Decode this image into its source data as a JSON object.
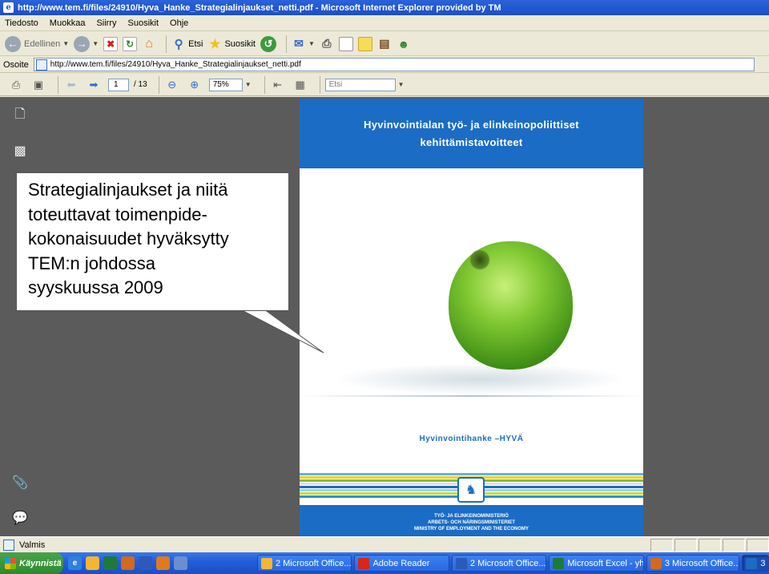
{
  "window": {
    "title": "http://www.tem.fi/files/24910/Hyva_Hanke_Strategialinjaukset_netti.pdf - Microsoft Internet Explorer provided by TM",
    "icon": "ie-icon"
  },
  "menu": [
    "Tiedosto",
    "Muokkaa",
    "Siirry",
    "Suosikit",
    "Ohje"
  ],
  "toolbar": {
    "back_label": "Edellinen",
    "search_label": "Etsi",
    "favorites_label": "Suosikit"
  },
  "address": {
    "label": "Osoite",
    "url": "http://www.tem.fi/files/24910/Hyva_Hanke_Strategialinjaukset_netti.pdf"
  },
  "pdf_toolbar": {
    "page_current": "1",
    "page_total": "/ 13",
    "zoom": "75%",
    "search_placeholder": "Etsi"
  },
  "pdf_page": {
    "title_line1": "Hyvinvointialan työ- ja elinkeinopoliittiset",
    "title_line2": "kehittämistavoitteet",
    "hanke": "Hyvinvointihanke –HYVÄ",
    "ministry_line1": "TYÖ- JA ELINKEINOMINISTERIÖ",
    "ministry_line2": "ARBETS- OCH NÄRINGSMINISTERIET",
    "ministry_line3": "MINISTRY OF EMPLOYMENT AND THE ECONOMY",
    "stripe_colors": [
      "#5fb3e8",
      "#f2d01c",
      "#7ac143",
      "#e0e0e0",
      "#1b6cc5",
      "#9ad3f0",
      "#c8dc3a",
      "#2d8fd8"
    ]
  },
  "callout": {
    "lines": [
      "Strategialinjaukset ja niitä",
      "toteuttavat toimenpide-",
      "kokonaisuudet hyväksytty",
      "TEM:n johdossa",
      "syyskuussa 2009"
    ]
  },
  "status": {
    "text": "Valmis"
  },
  "taskbar": {
    "start_label": "Käynnistä",
    "buttons": [
      {
        "label": "2 Microsoft Office...",
        "icon_color": "#f2b632"
      },
      {
        "label": "Adobe Reader",
        "icon_color": "#d8251d"
      },
      {
        "label": "2 Microsoft Office...",
        "icon_color": "#2b5ab8"
      },
      {
        "label": "Microsoft Excel - yh...",
        "icon_color": "#1d7a3a"
      },
      {
        "label": "3 Microsoft Office...",
        "icon_color": "#d2691e"
      },
      {
        "label": "3",
        "icon_color": "#1b6cc5"
      }
    ]
  }
}
